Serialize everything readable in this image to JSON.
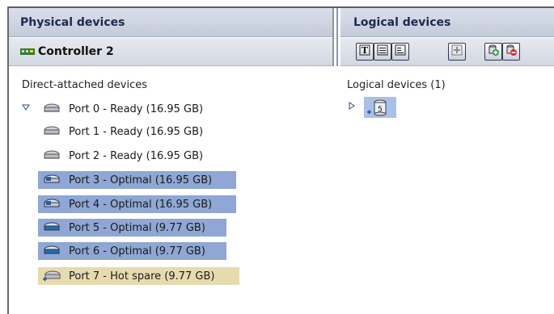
{
  "physical_panel": {
    "title": "Physical devices",
    "controller": "Controller 2",
    "section_label": "Direct-attached devices",
    "devices": [
      {
        "label": "Port 0 - Ready (16.95 GB)",
        "state": "ready"
      },
      {
        "label": "Port 1 - Ready (16.95 GB)",
        "state": "ready"
      },
      {
        "label": "Port 2 - Ready (16.95 GB)",
        "state": "ready"
      },
      {
        "label": "Port 3 - Optimal (16.95 GB)",
        "state": "optimal"
      },
      {
        "label": "Port 4 - Optimal (16.95 GB)",
        "state": "optimal"
      },
      {
        "label": "Port 5 - Optimal (9.77 GB)",
        "state": "optimal"
      },
      {
        "label": "Port 6 - Optimal (9.77 GB)",
        "state": "optimal"
      },
      {
        "label": "Port 7 - Hot spare (9.77 GB)",
        "state": "hot-spare"
      }
    ]
  },
  "logical_panel": {
    "title": "Logical devices",
    "section_label": "Logical devices (1)",
    "toolbar": [
      "text-view-icon",
      "list-view-icon",
      "detail-view-icon",
      "add-icon",
      "create-logical-device-icon",
      "delete-logical-device-icon"
    ],
    "device_badge": "5"
  },
  "colors": {
    "header_text": "#1c2a52",
    "selected_row": "#8fa7d4",
    "hot_spare_row": "#e6dbae",
    "logical_selected": "#a9c1e9"
  }
}
